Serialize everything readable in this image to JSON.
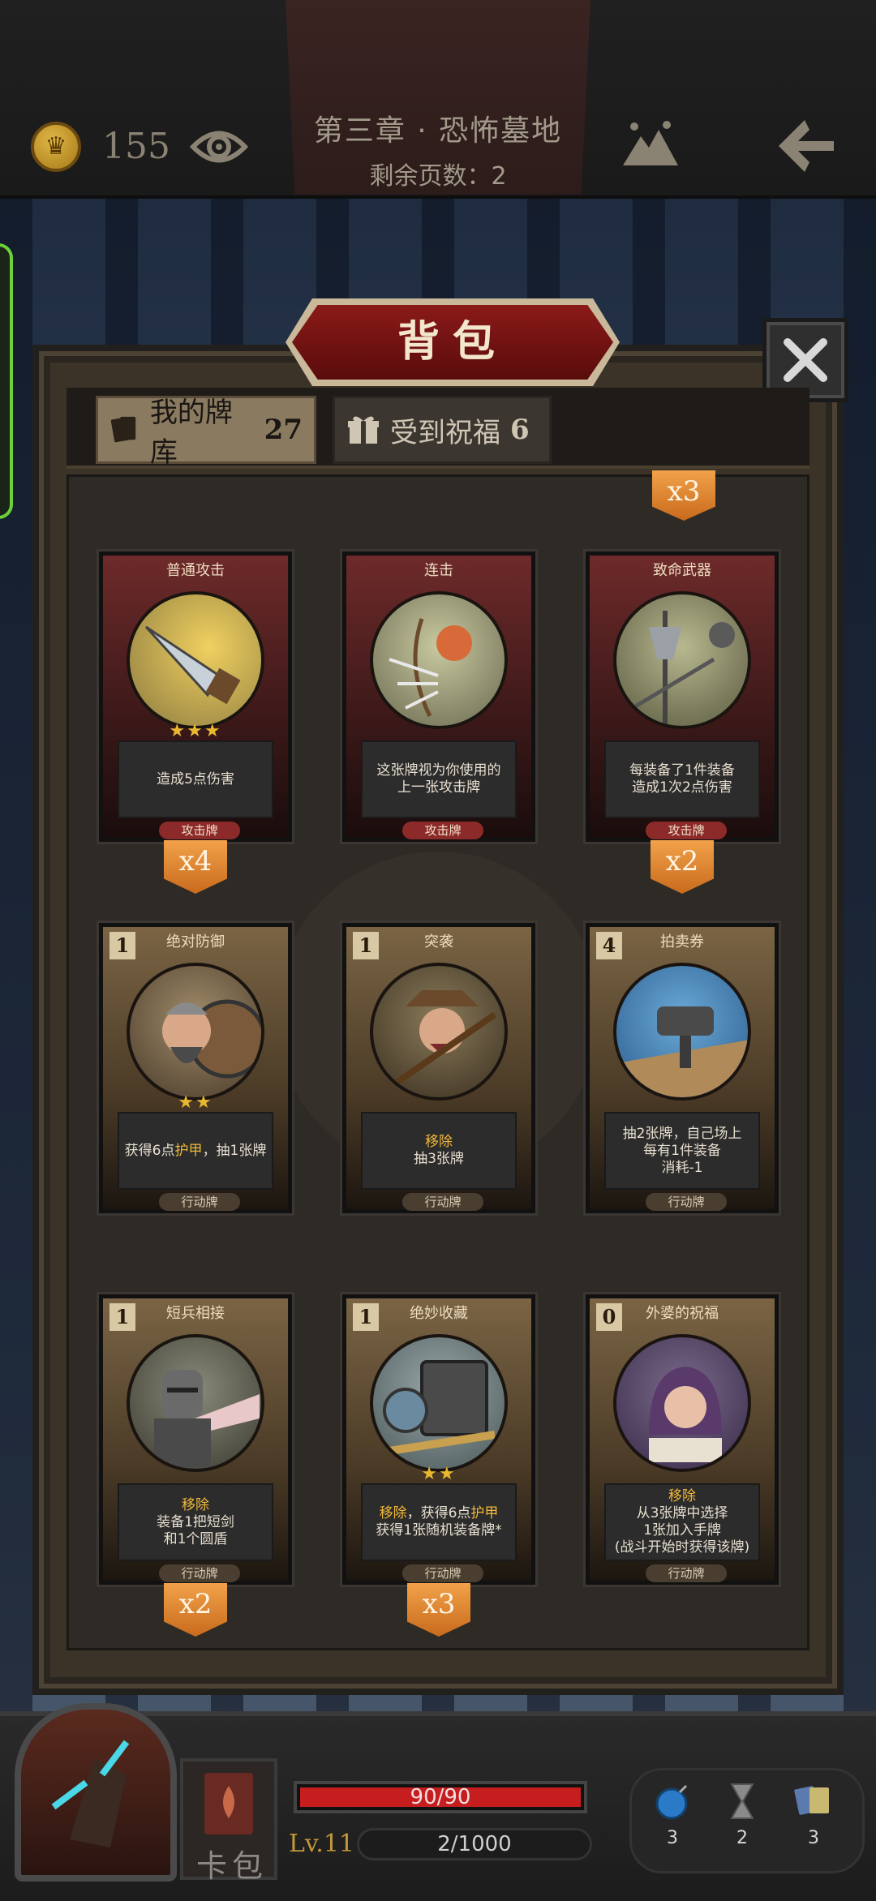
{
  "header": {
    "coins": "155",
    "chapter_title": "第三章 · 恐怖墓地",
    "pages_left": "剩余页数：2"
  },
  "panel": {
    "title": "背包",
    "tabs": [
      {
        "label": "我的牌库",
        "count": "27"
      },
      {
        "label": "受到祝福",
        "count": "6"
      }
    ],
    "top_badge": "x3"
  },
  "cards": [
    {
      "name": "普通攻击",
      "cost": "",
      "stars": "★★★",
      "desc": [
        "造成5点伤害"
      ],
      "keyword": "",
      "type": "攻击牌",
      "count": "x4"
    },
    {
      "name": "连击",
      "cost": "",
      "stars": "",
      "desc": [
        "这张牌视为你使用的",
        "上一张攻击牌"
      ],
      "keyword": "",
      "type": "攻击牌",
      "count": ""
    },
    {
      "name": "致命武器",
      "cost": "",
      "stars": "",
      "desc": [
        "每装备了1件装备",
        "造成1次2点伤害"
      ],
      "keyword": "",
      "type": "攻击牌",
      "count": "x2"
    },
    {
      "name": "绝对防御",
      "cost": "1",
      "stars": "★★",
      "desc_parts": [
        "获得6点",
        "护甲",
        "，抽1张牌"
      ],
      "type": "行动牌",
      "count": ""
    },
    {
      "name": "突袭",
      "cost": "1",
      "stars": "",
      "keyword": "移除",
      "desc": [
        "抽3张牌"
      ],
      "type": "行动牌",
      "count": ""
    },
    {
      "name": "拍卖券",
      "cost": "4",
      "stars": "",
      "desc": [
        "抽2张牌，自己场上",
        "每有1件装备",
        "消耗-1"
      ],
      "keyword": "",
      "type": "行动牌",
      "count": ""
    },
    {
      "name": "短兵相接",
      "cost": "1",
      "stars": "",
      "keyword": "移除",
      "desc": [
        "装备1把短剑",
        "和1个圆盾"
      ],
      "type": "行动牌",
      "count": "x2"
    },
    {
      "name": "绝妙收藏",
      "cost": "1",
      "stars": "★★",
      "line1_parts": [
        "移除",
        "，获得6点",
        "护甲"
      ],
      "desc": [
        "获得1张随机装备牌*"
      ],
      "type": "行动牌",
      "count": "x3"
    },
    {
      "name": "外婆的祝福",
      "cost": "0",
      "stars": "",
      "keyword": "移除",
      "desc": [
        "从3张牌中选择",
        "1张加入手牌",
        "(战斗开始时获得该牌)"
      ],
      "type": "行动牌",
      "count": ""
    }
  ],
  "footer": {
    "deck_label": "卡包",
    "hp_text": "90/90",
    "hp_fraction": 1.0,
    "level": "Lv.11",
    "xp_text": "2/1000",
    "items": [
      {
        "icon": "bomb-icon",
        "count": "3"
      },
      {
        "icon": "hourglass-icon",
        "count": "2"
      },
      {
        "icon": "cards-icon",
        "count": "3"
      }
    ]
  },
  "colors": {
    "accent_red": "#8c2a2a",
    "keyword_gold": "#f0b83a",
    "badge_orange": "#d88a38"
  }
}
